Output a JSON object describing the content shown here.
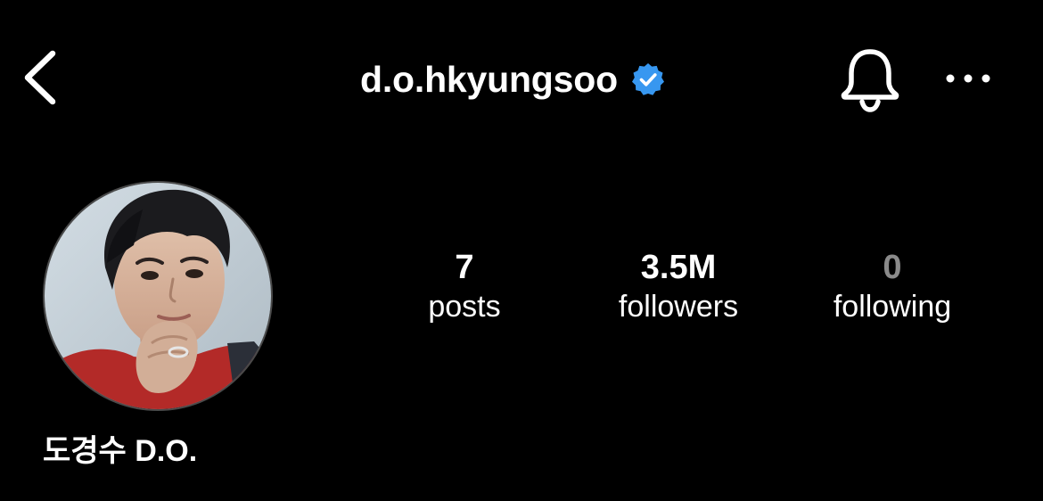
{
  "header": {
    "username": "d.o.hkyungsoo",
    "back_icon": "chevron-left-icon",
    "verified_icon": "verified-badge-icon",
    "bell_icon": "bell-icon",
    "more_icon": "more-horizontal-icon",
    "accent_color": "#3797F0"
  },
  "profile": {
    "display_name": "도경수 D.O.",
    "avatar_icon": "profile-photo"
  },
  "stats": [
    {
      "value": "7",
      "label": "posts"
    },
    {
      "value": "3.5M",
      "label": "followers"
    },
    {
      "value": "0",
      "label": "following"
    }
  ],
  "colors": {
    "background": "#000000",
    "text": "#FFFFFF",
    "muted_value": "#8A8A8A"
  }
}
